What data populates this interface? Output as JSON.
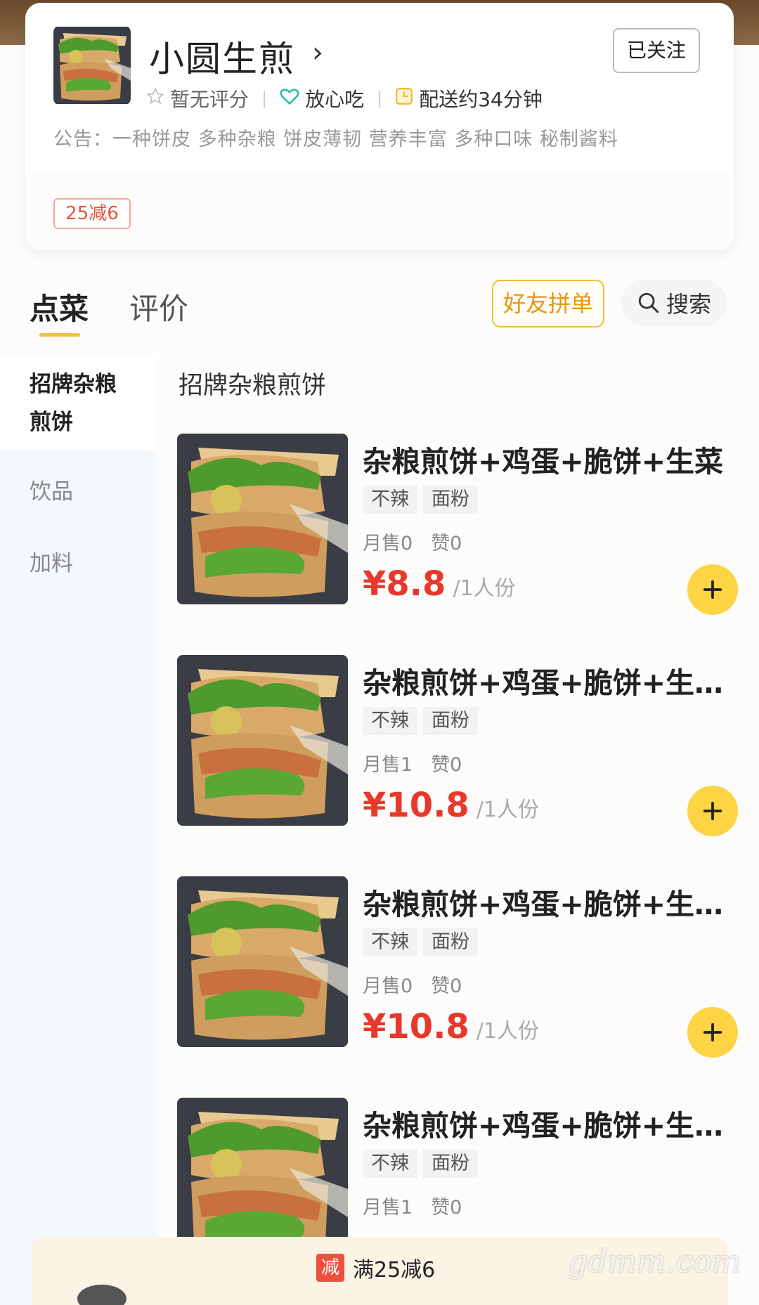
{
  "shop": {
    "name": "小圆生煎",
    "follow_label": "已关注",
    "rating": "暂无评分",
    "safe_label": "放心吃",
    "delivery": "配送约34分钟",
    "notice": "公告：一种饼皮 多种杂粮 饼皮薄韧 营养丰富 多种口味 秘制酱料",
    "promo_tag": "25减6"
  },
  "tabs": [
    {
      "label": "点菜"
    },
    {
      "label": "评价"
    }
  ],
  "actions": {
    "friend_order": "好友拼单",
    "search": "搜索"
  },
  "sidebar": {
    "items": [
      {
        "label": "招牌杂粮煎饼"
      },
      {
        "label": "饮品"
      },
      {
        "label": "加料"
      }
    ]
  },
  "section_title": "招牌杂粮煎饼",
  "products": [
    {
      "name": "杂粮煎饼+鸡蛋+脆饼+生菜",
      "tags": [
        "不辣",
        "面粉"
      ],
      "sales": "月售0",
      "likes": "赞0",
      "price": "¥8.8",
      "unit": "/1人份"
    },
    {
      "name": "杂粮煎饼+鸡蛋+脆饼+生…",
      "tags": [
        "不辣",
        "面粉"
      ],
      "sales": "月售1",
      "likes": "赞0",
      "price": "¥10.8",
      "unit": "/1人份"
    },
    {
      "name": "杂粮煎饼+鸡蛋+脆饼+生…",
      "tags": [
        "不辣",
        "面粉"
      ],
      "sales": "月售0",
      "likes": "赞0",
      "price": "¥10.8",
      "unit": "/1人份"
    },
    {
      "name": "杂粮煎饼+鸡蛋+脆饼+生…",
      "tags": [
        "不辣",
        "面粉"
      ],
      "sales": "月售1",
      "likes": "赞0",
      "price": "",
      "unit": ""
    }
  ],
  "bottom_bar": {
    "badge": "减",
    "text": "满25减6"
  },
  "watermark": "gdmm.com",
  "colors": {
    "accent_yellow": "#fcd444",
    "price_red": "#e8382c",
    "tab_underline": "#f5c04a",
    "friend_btn_orange": "#e8960c"
  }
}
